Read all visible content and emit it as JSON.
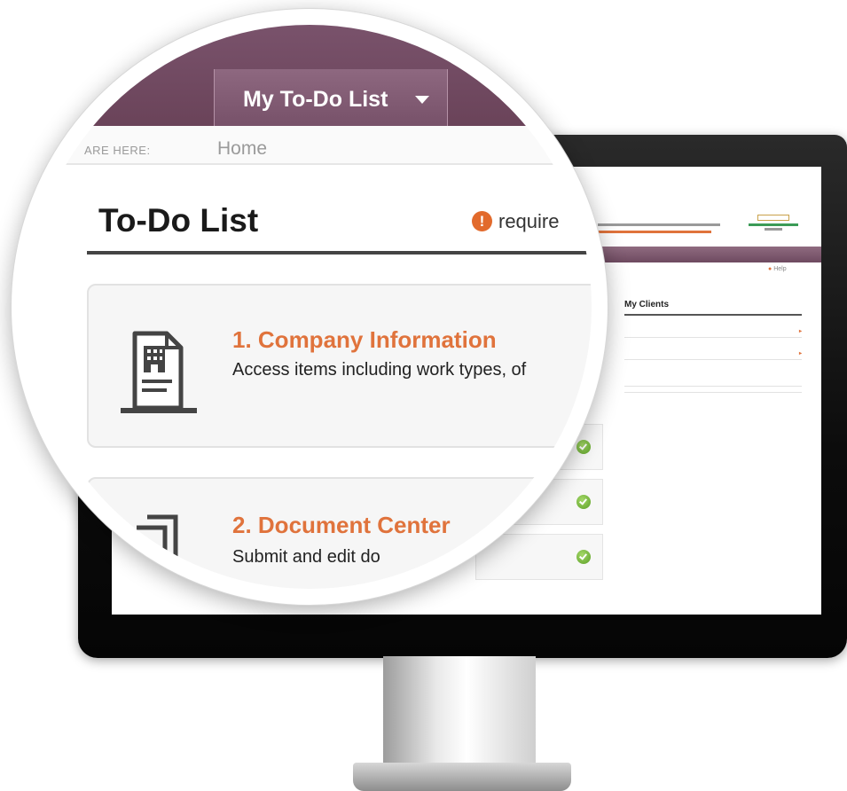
{
  "magnifier": {
    "nav": {
      "tab_todo_label": "My To-Do List"
    },
    "breadcrumb": {
      "label": "ARE HERE:",
      "value": "Home"
    },
    "page_title": "To-Do List",
    "required_label": "require",
    "cards": [
      {
        "title": "1. Company Information",
        "description": "Access items including work types, of",
        "icon": "building-document-icon"
      },
      {
        "title": "2. Document Center",
        "description": "Submit and edit do",
        "icon": "documents-icon"
      }
    ]
  },
  "screen": {
    "help_label": "Help",
    "clients": {
      "title": "My Clients"
    }
  },
  "colors": {
    "nav_purple": "#7d5670",
    "accent_orange": "#e0733c",
    "check_green": "#6aaa33"
  }
}
